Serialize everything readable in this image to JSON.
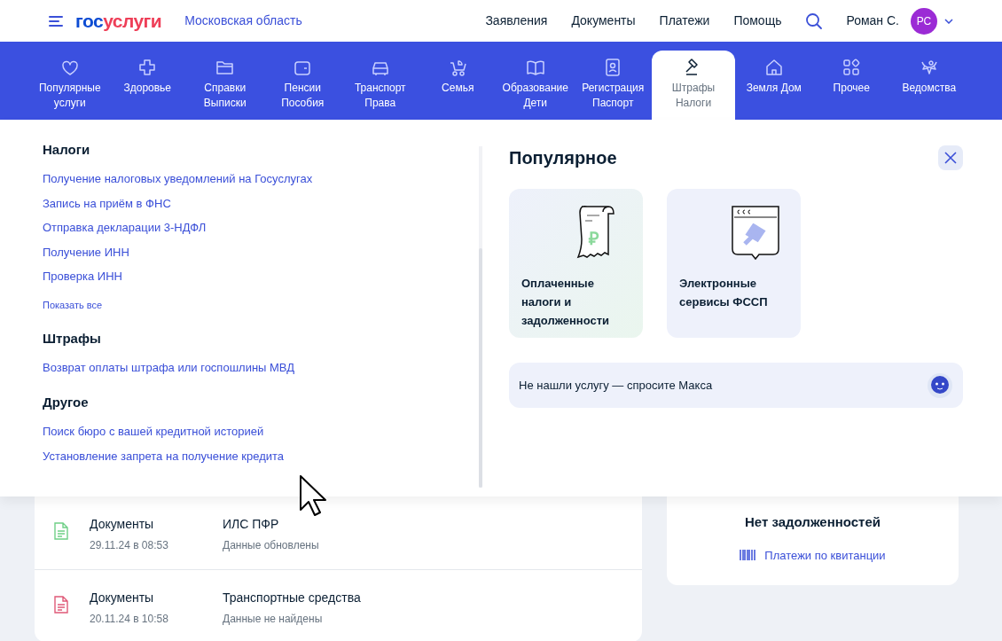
{
  "header": {
    "logo": "госуслуги",
    "region": "Московская область",
    "nav": [
      "Заявления",
      "Документы",
      "Платежи",
      "Помощь"
    ],
    "user": {
      "name": "Роман С.",
      "initials": "РС"
    }
  },
  "categories": [
    {
      "label": "Популярные услуги",
      "selected": false
    },
    {
      "label": "Здоровье",
      "selected": false
    },
    {
      "label": "Справки Выписки",
      "selected": false
    },
    {
      "label": "Пенсии Пособия",
      "selected": false
    },
    {
      "label": "Транспорт Права",
      "selected": false
    },
    {
      "label": "Семья",
      "selected": false
    },
    {
      "label": "Образование Дети",
      "selected": false
    },
    {
      "label": "Регистрация Паспорт",
      "selected": false
    },
    {
      "label": "Штрафы Налоги",
      "selected": true
    },
    {
      "label": "Земля Дом",
      "selected": false
    },
    {
      "label": "Прочее",
      "selected": false
    },
    {
      "label": "Ведомства",
      "selected": false
    }
  ],
  "sections": [
    {
      "title": "Налоги",
      "links": [
        "Получение налоговых уведомлений на Госуслугах",
        "Запись на приём в ФНС",
        "Отправка декларации 3-НДФЛ",
        "Получение ИНН",
        "Проверка ИНН"
      ],
      "show_all": "Показать все"
    },
    {
      "title": "Штрафы",
      "links": [
        "Возврат оплаты штрафа или госпошлины МВД"
      ]
    },
    {
      "title": "Другое",
      "links": [
        "Поиск бюро с вашей кредитной историей",
        "Установление запрета на получение кредита"
      ]
    }
  ],
  "popular": {
    "title": "Популярное",
    "cards": [
      {
        "kind": "receipt",
        "symbol": "₽",
        "label": "Оплаченные налоги и задолженности"
      },
      {
        "kind": "court",
        "label": "Электронные сервисы ФССП"
      }
    ],
    "ask": "Не нашли услугу — спросите Макса"
  },
  "events": [
    {
      "kind": "ok",
      "type": "Документы",
      "date": "29.11.24 в 08:53",
      "title": "ИЛС ПФР",
      "status": "Данные обновлены"
    },
    {
      "kind": "error",
      "type": "Документы",
      "date": "20.11.24 в 10:58",
      "title": "Транспортные средства",
      "status": "Данные не найдены"
    }
  ],
  "debts": {
    "title": "Нет задолженностей",
    "link": "Платежи по квитанции"
  }
}
